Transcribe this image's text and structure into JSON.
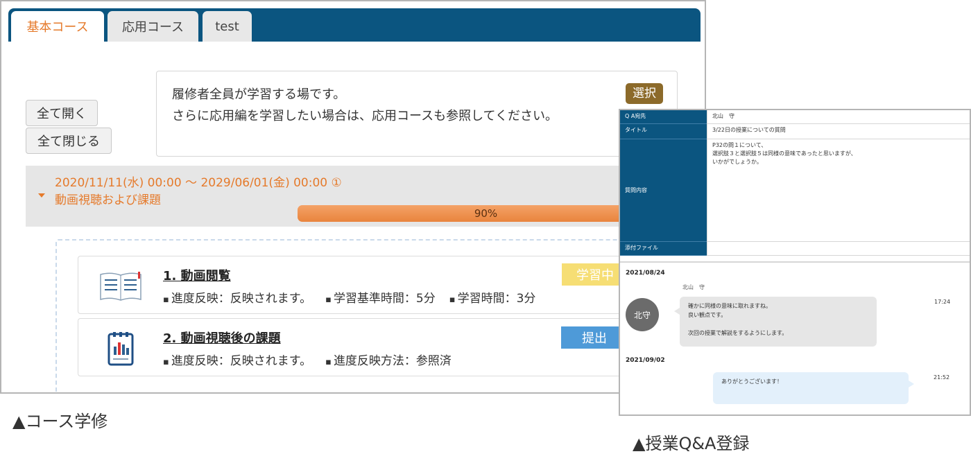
{
  "course_page": {
    "tabs": [
      {
        "label": "基本コース",
        "active": true
      },
      {
        "label": "応用コース",
        "active": false
      },
      {
        "label": "test",
        "active": false
      }
    ],
    "open_all_label": "全て開く",
    "close_all_label": "全て閉じる",
    "description": {
      "line1": "履修者全員が学習する場です。",
      "line2": "さらに応用編を学習したい場合は、応用コースも参照してください。",
      "select_label": "選択"
    },
    "section": {
      "date_range": "2020/11/11(水) 00:00 〜 2029/06/01(金) 00:00 ①",
      "title": "動画視聴および課題",
      "progress_percent": 90,
      "progress_label": "90%"
    },
    "items": [
      {
        "title": "1. 動画閲覧",
        "meta": [
          "進度反映：反映されます。",
          "学習基準時間：5分",
          "学習時間：3分"
        ],
        "status": "学習中",
        "icon": "book-icon"
      },
      {
        "title": "2. 動画視聴後の課題",
        "meta": [
          "進度反映：反映されます。",
          "進度反映方法：参照済"
        ],
        "status": "提出",
        "icon": "report-icon"
      }
    ],
    "caption": "▲コース学修"
  },
  "qa_page": {
    "fields": [
      {
        "label": "Q A宛先",
        "value": "北山　守"
      },
      {
        "label": "タイトル",
        "value": "3/22日の授業についての質問"
      },
      {
        "label": "質問内容",
        "value": "P32の問１について、\n選択肢３と選択肢５は同様の意味であったと思いますが、\nいかがでしょうか。"
      },
      {
        "label": "添付ファイル",
        "value": ""
      }
    ],
    "messages": [
      {
        "date": "2021/08/24",
        "sender": "北山　守",
        "avatar_text": "北守",
        "text": "確かに同様の意味に取れますね。\n良い観点です。\n\n次回の授業で解説をするようにします。",
        "time": "17:24"
      },
      {
        "date": "2021/09/02",
        "text": "ありがとうございます！",
        "time": "21:52"
      }
    ],
    "caption": "▲授業Q&A登録"
  },
  "colors": {
    "tab_bar": "#0b5580",
    "accent_orange": "#e57a2b",
    "status_studying": "#f6de74",
    "status_submit": "#4e9ad8",
    "select_button": "#8c6a2a"
  }
}
